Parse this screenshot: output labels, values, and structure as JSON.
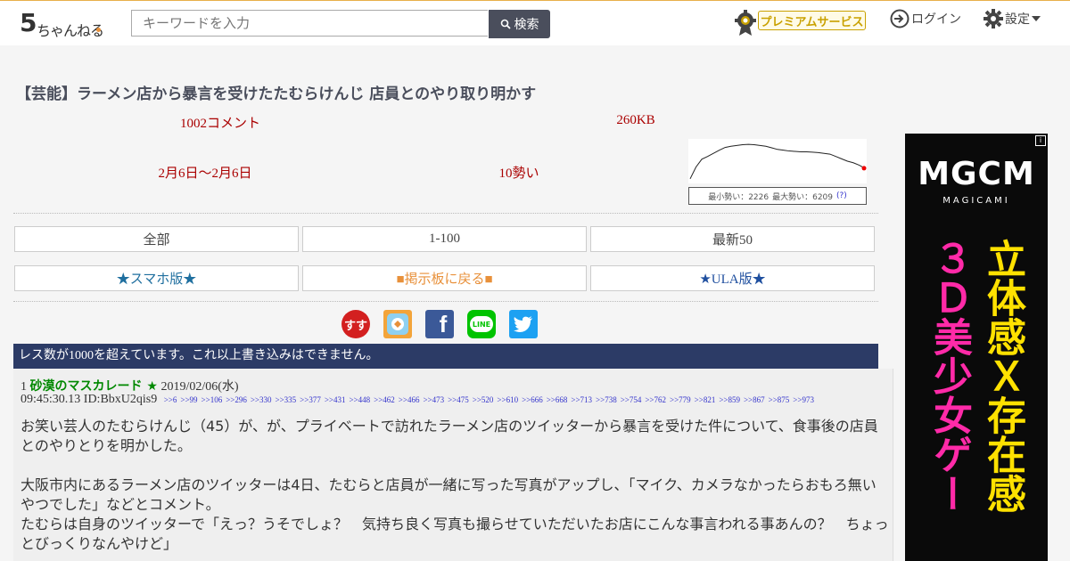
{
  "header": {
    "logo": {
      "five": "5",
      "kana": "ちゃんねる"
    },
    "search": {
      "placeholder": "キーワードを入力",
      "button_label": "検索"
    },
    "premium_label": "プレミアムサービス",
    "login_label": "ログイン",
    "settings_label": "設定"
  },
  "thread": {
    "title": "【芸能】ラーメン店から暴言を受けたたむらけんじ 店員とのやり取り明かす",
    "comments": "1002コメント",
    "size": "260KB",
    "period": "2月6日〜2月6日",
    "momentum": "10勢い",
    "graph": {
      "min_label": "最小勢い：2226",
      "max_label": "最大勢い：6209",
      "help": "(?)",
      "series": [
        0.05,
        0.35,
        0.55,
        0.62,
        0.7,
        0.78,
        0.85,
        0.88,
        0.9,
        0.92,
        0.93,
        0.92,
        0.9,
        0.88,
        0.84,
        0.8,
        0.78,
        0.76,
        0.75,
        0.74,
        0.74,
        0.73,
        0.72,
        0.7,
        0.68,
        0.62,
        0.56,
        0.5,
        0.46,
        0.4,
        0.32
      ]
    }
  },
  "nav": {
    "all": "全部",
    "first100": "1-100",
    "latest50": "最新50",
    "smartphone": "★スマホ版★",
    "back_to_board": "■掲示板に戻る■",
    "ula": "★ULA版★"
  },
  "social": {
    "sumasu": "すす",
    "facebook": "f",
    "line": "LINE"
  },
  "notice": "レス数が1000を超えています。これ以上書き込みはできません。",
  "post": {
    "number": "1",
    "name": "砂漠のマスカレード ★",
    "date": "2019/02/06(水)",
    "time_id": "09:45:30.13 ID:BbxU2qis9",
    "replies": [
      ">>6",
      ">>99",
      ">>106",
      ">>296",
      ">>330",
      ">>335",
      ">>377",
      ">>431",
      ">>448",
      ">>462",
      ">>466",
      ">>473",
      ">>475",
      ">>520",
      ">>610",
      ">>666",
      ">>668",
      ">>713",
      ">>738",
      ">>754",
      ">>762",
      ">>779",
      ">>821",
      ">>859",
      ">>867",
      ">>875",
      ">>973"
    ],
    "body": [
      "お笑い芸人のたむらけんじ（45）が、が、プライベートで訪れたラーメン店のツイッターから暴言を受けた件について、食事後の店員とのやりとりを明かした。",
      "大阪市内にあるラーメン店のツイッターは4日、たむらと店員が一緒に写った写真がアップし、「マイク、カメラなかったらおもろ無いやつでした」などとコメント。\nたむらは自身のツイッターで「えっ？うそでしょ？　気持ち良く写真も撮らせていただいたお店にこんな事言われる事あんの？　ちょっとびっくりなんやけど」"
    ]
  },
  "ad": {
    "logo": "MGCM",
    "sub": "MAGICAMI",
    "col_right": "立体感Ｘ存在感",
    "col_left": "３Ｄ美少女ゲー",
    "info": "i",
    "colors": {
      "yellow": "#ffe100",
      "pink": "#ff2aa8",
      "red": "#d3002a"
    }
  }
}
